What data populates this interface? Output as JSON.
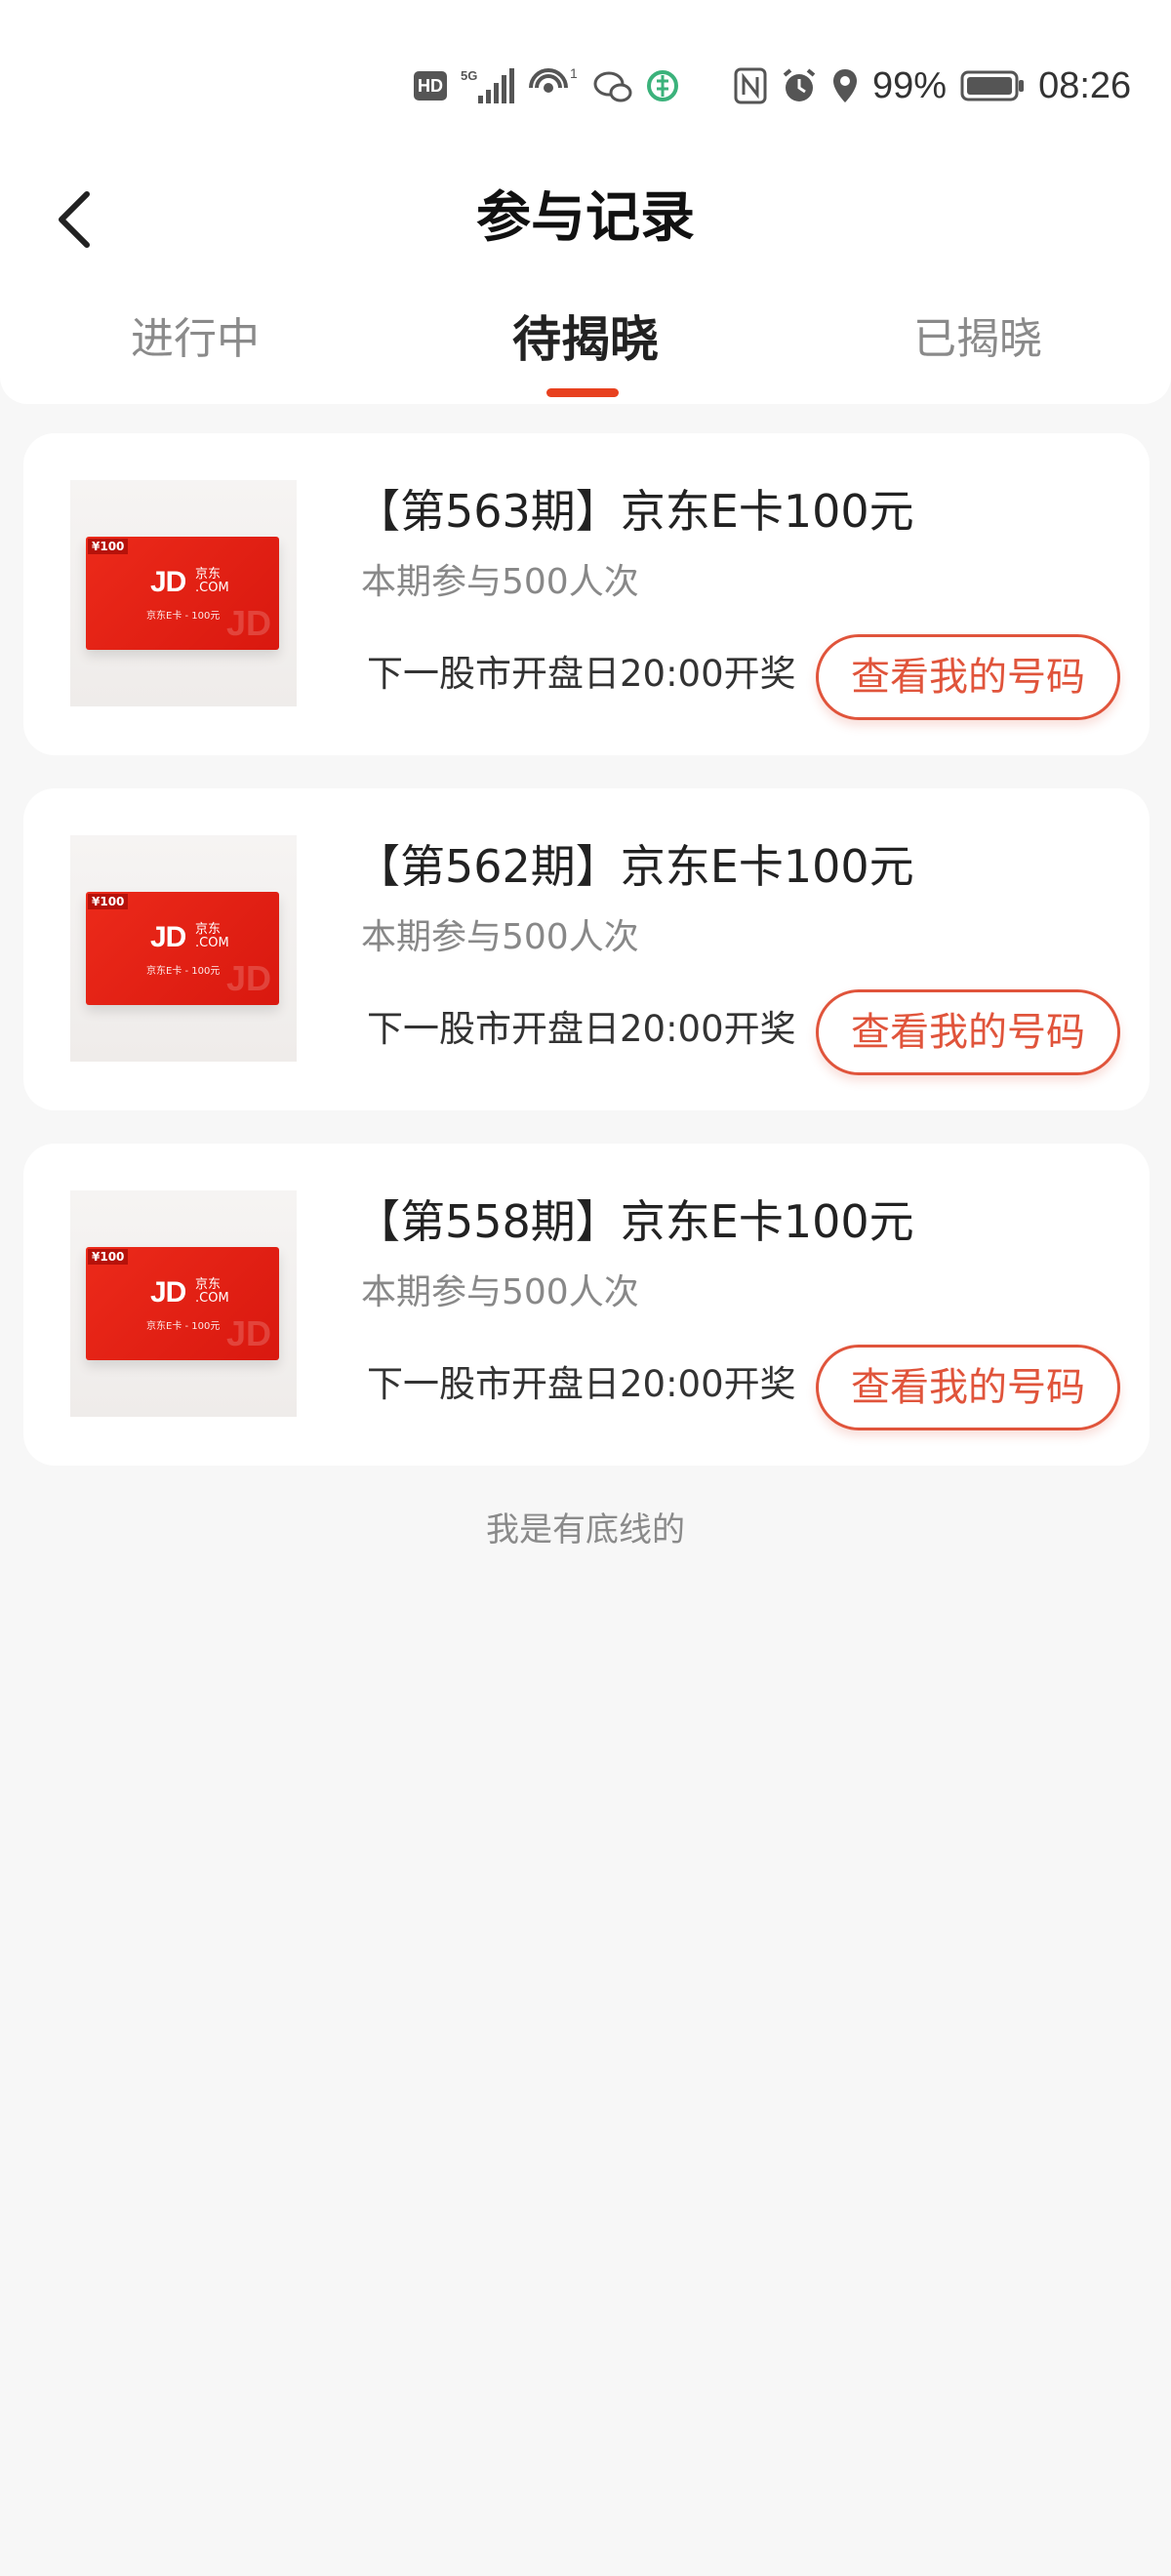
{
  "status_bar": {
    "hd": "HD",
    "network": "5G",
    "wifi_sup": "1",
    "battery": "99%",
    "time": "08:26"
  },
  "header": {
    "title": "参与记录"
  },
  "tabs": [
    {
      "label": "进行中"
    },
    {
      "label": "待揭晓"
    },
    {
      "label": "已揭晓"
    }
  ],
  "active_tab": "待揭晓",
  "records": [
    {
      "title": "【第563期】京东E卡100元",
      "participants": "本期参与500人次",
      "draw_time": "下一股市开盘日20:00开奖",
      "button": "查看我的号码"
    },
    {
      "title": "【第562期】京东E卡100元",
      "participants": "本期参与500人次",
      "draw_time": "下一股市开盘日20:00开奖",
      "button": "查看我的号码"
    },
    {
      "title": "【第558期】京东E卡100元",
      "participants": "本期参与500人次",
      "draw_time": "下一股市开盘日20:00开奖",
      "button": "查看我的号码"
    }
  ],
  "thumbnail": {
    "tag": "¥100",
    "logo": "JD",
    "logo_cn": "京东",
    "logo_com": ".COM",
    "sub": "京东E卡 - 100元",
    "watermark": "JD"
  },
  "footer": "我是有底线的",
  "colors": {
    "accent": "#e8411f",
    "button": "#e0543b",
    "card_red": "#e0241a"
  }
}
